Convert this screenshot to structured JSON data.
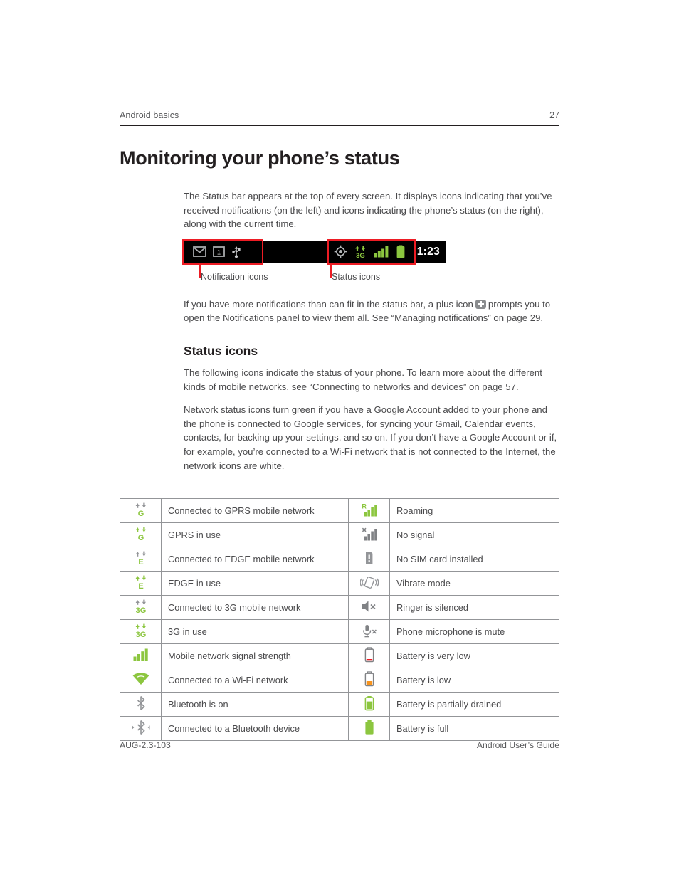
{
  "runhead": {
    "left": "Android basics",
    "page_number": "27"
  },
  "title": "Monitoring your phone’s status",
  "intro": "The Status bar appears at the top of every screen. It displays icons indicating that you’ve received notifications (on the left) and icons indicating the phone’s status (on the right), along with the current time.",
  "figure": {
    "status_bar": {
      "time": "1:23",
      "notification_icons": [
        "gmail-icon",
        "message-count-icon",
        "usb-icon"
      ],
      "message_count": "1",
      "status_icons": [
        "gps-icon",
        "3g-icon",
        "signal-bars-icon",
        "battery-icon"
      ],
      "network_label": "3G"
    },
    "caption_left": "Notification icons",
    "caption_right": "Status icons"
  },
  "paragraph_plus": {
    "before": "If you have more notifications than can fit in the status bar, a plus icon",
    "after": "prompts you to open the Notifications panel to view them all. See “Managing notifications” on page 29."
  },
  "status_icons_section": {
    "heading": "Status icons",
    "p1": "The following icons indicate the status of your phone. To learn more about the different kinds of mobile networks, see “Connecting to networks and devices” on page 57.",
    "p2": "Network status icons turn green if you have a Google Account added to your phone and the phone is connected to Google services, for syncing your Gmail, Calendar events, contacts, for backing up your settings, and so on. If you don’t have a Google Account or if, for example, you’re connected to a Wi-Fi network that is not connected to the Internet, the network icons are white."
  },
  "table": {
    "rows": [
      {
        "left_icon": "gprs-connected-icon",
        "left_label": "Connected to GPRS mobile network",
        "right_icon": "roaming-icon",
        "right_label": "Roaming"
      },
      {
        "left_icon": "gprs-in-use-icon",
        "left_label": "GPRS in use",
        "right_icon": "no-signal-icon",
        "right_label": "No signal"
      },
      {
        "left_icon": "edge-connected-icon",
        "left_label": "Connected to EDGE mobile network",
        "right_icon": "no-sim-icon",
        "right_label": "No SIM card installed"
      },
      {
        "left_icon": "edge-in-use-icon",
        "left_label": "EDGE in use",
        "right_icon": "vibrate-icon",
        "right_label": "Vibrate mode"
      },
      {
        "left_icon": "3g-connected-icon",
        "left_label": "Connected to 3G mobile network",
        "right_icon": "ringer-silenced-icon",
        "right_label": "Ringer is silenced"
      },
      {
        "left_icon": "3g-in-use-icon",
        "left_label": "3G in use",
        "right_icon": "microphone-mute-icon",
        "right_label": "Phone microphone is mute"
      },
      {
        "left_icon": "signal-strength-icon",
        "left_label": "Mobile network signal strength",
        "right_icon": "battery-very-low-icon",
        "right_label": "Battery is very low"
      },
      {
        "left_icon": "wifi-icon",
        "left_label": "Connected to a Wi-Fi network",
        "right_icon": "battery-low-icon",
        "right_label": "Battery is low"
      },
      {
        "left_icon": "bluetooth-on-icon",
        "left_label": "Bluetooth is on",
        "right_icon": "battery-partial-icon",
        "right_label": "Battery is partially drained"
      },
      {
        "left_icon": "bluetooth-connected-icon",
        "left_label": "Connected to a Bluetooth device",
        "right_icon": "battery-full-icon",
        "right_label": "Battery is full"
      }
    ],
    "network_letters": {
      "gprs": "G",
      "edge": "E",
      "threeg": "3G"
    },
    "roaming_badge": "R"
  },
  "footer": {
    "left": "AUG-2.3-103",
    "right": "Android User’s Guide"
  },
  "colors": {
    "green": "#8cc63f",
    "green_dark": "#7ab52c",
    "gray": "#939598",
    "gray_dark": "#6d6e71",
    "red": "#ed1c24",
    "orange": "#f7941e",
    "battery_red": "#ed1c24",
    "black": "#000000"
  }
}
